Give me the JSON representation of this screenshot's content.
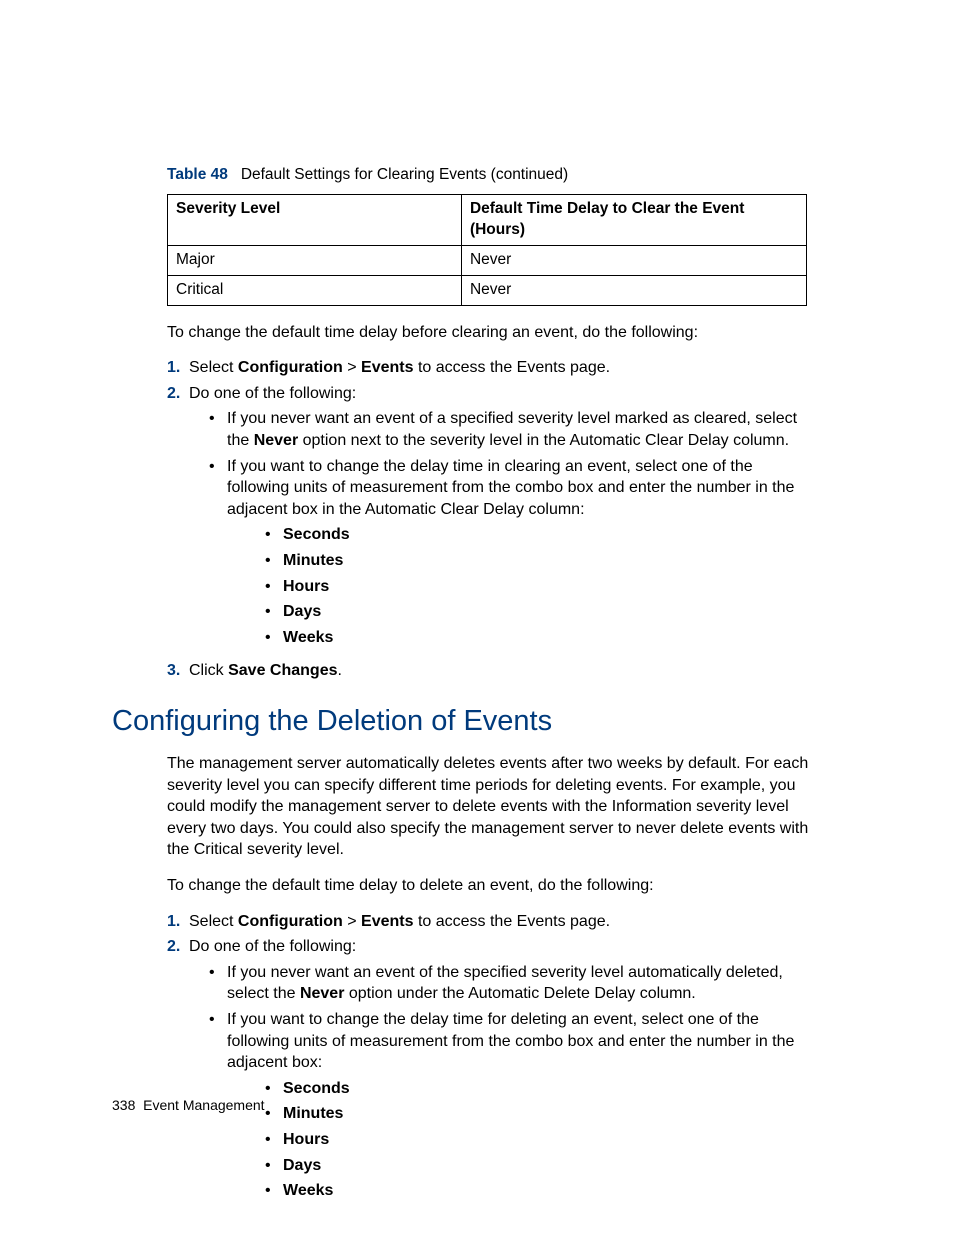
{
  "tableCaption": {
    "label": "Table 48",
    "text": "Default Settings for Clearing Events (continued)"
  },
  "table": {
    "h1": "Severity Level",
    "h2": "Default Time Delay to Clear the Event (Hours)",
    "r1c1": "Major",
    "r1c2": "Never",
    "r2c1": "Critical",
    "r2c2": "Never"
  },
  "clear": {
    "intro": "To change the default time delay before clearing an event, do the following:",
    "step1_a": "Select ",
    "step1_b": "Configuration",
    "step1_c": " > ",
    "step1_d": "Events",
    "step1_e": " to access the Events page.",
    "step2": "Do one of the following:",
    "b1_a": "If you never want an event of a specified severity level marked as cleared, select the ",
    "b1_b": "Never",
    "b1_c": " option next to the severity level in the Automatic Clear Delay column.",
    "b2": "If you want to change the delay time in clearing an event, select one of the following units of measurement from the combo box and enter the number in the adjacent box in the Automatic Clear Delay column:",
    "u1": "Seconds",
    "u2": "Minutes",
    "u3": "Hours",
    "u4": "Days",
    "u5": "Weeks",
    "step3_a": "Click ",
    "step3_b": "Save Changes",
    "step3_c": "."
  },
  "heading": "Configuring the Deletion of Events",
  "delete": {
    "para": "The management server automatically deletes events after two weeks by default. For each severity level you can specify different time periods for deleting events. For example, you could modify the management server to delete events with the Information severity level every two days. You could also specify the management server to never delete events with the Critical severity level.",
    "intro": "To change the default time delay to delete an event, do the following:",
    "step1_a": "Select ",
    "step1_b": "Configuration",
    "step1_c": " > ",
    "step1_d": "Events",
    "step1_e": " to access the Events page.",
    "step2": "Do one of the following:",
    "b1_a": "If you never want an event of the specified severity level automatically deleted, select the ",
    "b1_b": "Never",
    "b1_c": " option under the Automatic Delete Delay column.",
    "b2": "If you want to change the delay time for deleting an event, select one of the following units of measurement from the combo box and enter the number in the adjacent box:",
    "u1": "Seconds",
    "u2": "Minutes",
    "u3": "Hours",
    "u4": "Days",
    "u5": "Weeks"
  },
  "footer": {
    "pageNum": "338",
    "section": "Event Management"
  }
}
